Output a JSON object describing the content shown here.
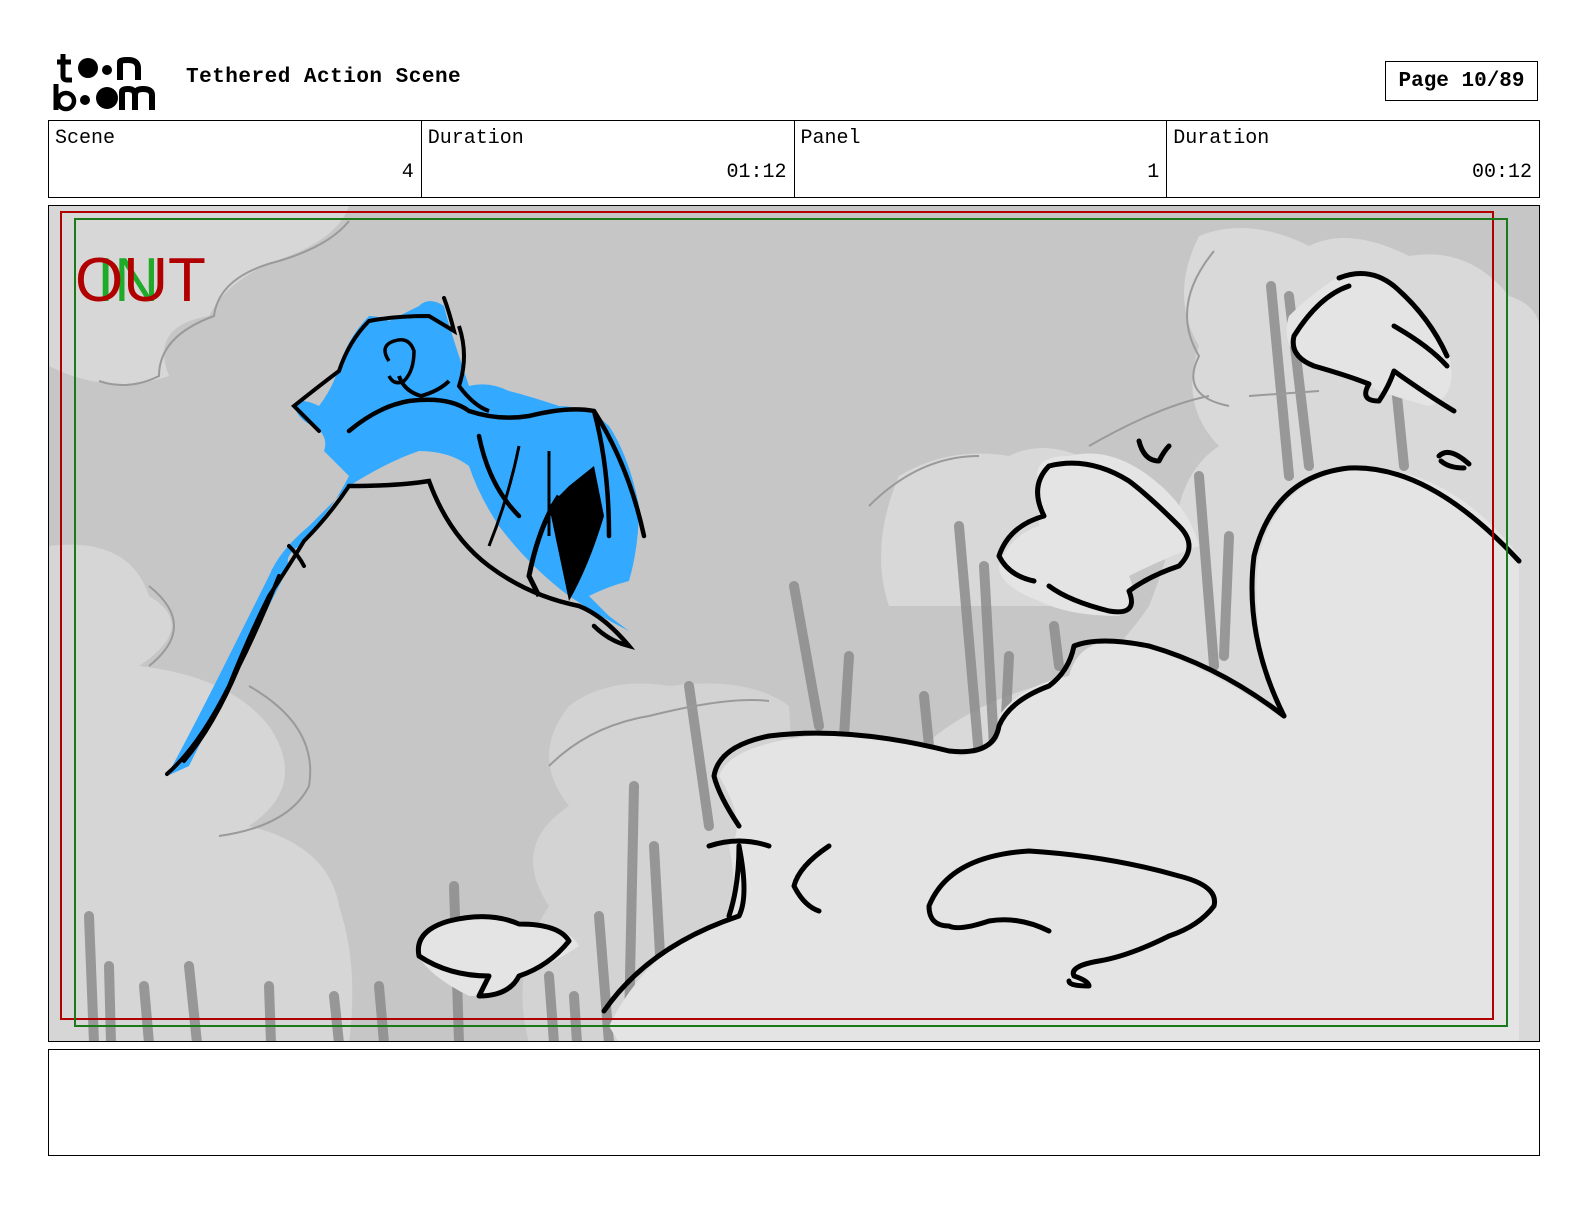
{
  "header": {
    "logo": {
      "text_top": "toon",
      "text_bottom": "boom"
    },
    "title": "Tethered Action Scene",
    "page": "Page 10/89"
  },
  "info": {
    "scene": {
      "label": "Scene",
      "value": "4"
    },
    "scene_duration": {
      "label": "Duration",
      "value": "01:12"
    },
    "panel": {
      "label": "Panel",
      "value": "1"
    },
    "panel_duration": {
      "label": "Duration",
      "value": "00:12"
    }
  },
  "frame": {
    "in_marker": "IN",
    "out_marker": "OUT",
    "colors": {
      "in": "#1faa2a",
      "out": "#b00000",
      "character": "#33aaff"
    }
  },
  "notes": {
    "text": ""
  }
}
